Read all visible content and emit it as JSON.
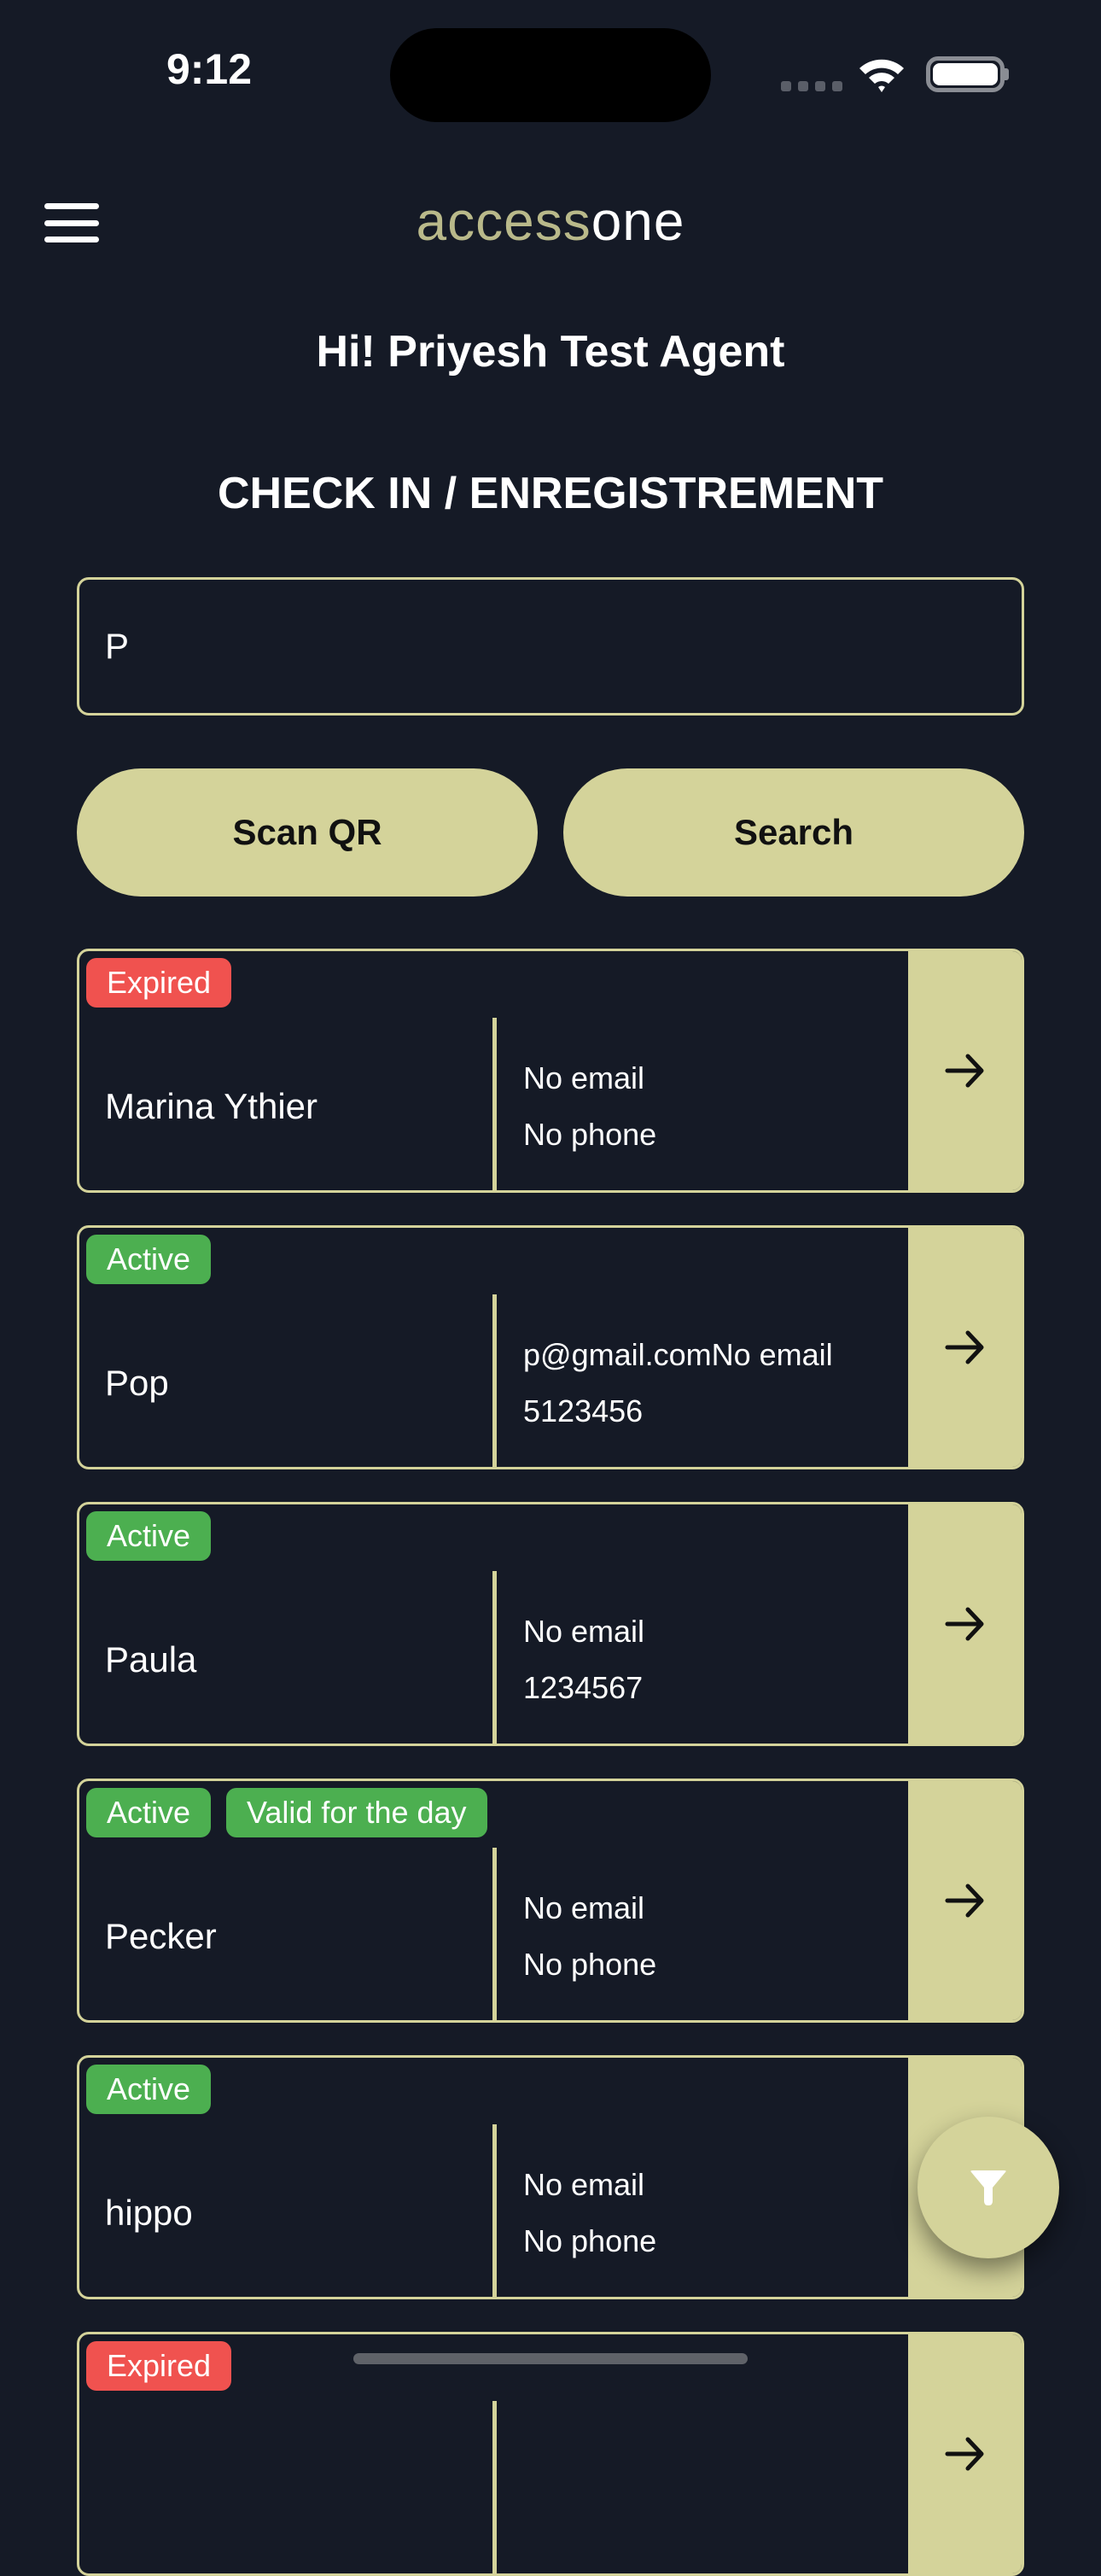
{
  "status_bar": {
    "time": "9:12",
    "signal-icon": "signal-dots",
    "wifi-icon": "wifi",
    "battery-icon": "battery-full"
  },
  "header": {
    "menu_icon": "hamburger-menu",
    "logo_part1": "access",
    "logo_part2": "one"
  },
  "greeting": "Hi! Priyesh Test Agent",
  "page_title": "CHECK IN / ENREGISTREMENT",
  "search": {
    "value": "P"
  },
  "buttons": {
    "scan_qr": "Scan QR",
    "search": "Search"
  },
  "colors": {
    "background": "#151a26",
    "accent": "#d4d39a",
    "expired": "#f0524f",
    "active": "#4caf50"
  },
  "members": [
    {
      "badges": [
        {
          "label": "Expired",
          "type": "expired"
        }
      ],
      "name": "Marina Ythier",
      "email": "No email",
      "phone": "No phone"
    },
    {
      "badges": [
        {
          "label": "Active",
          "type": "active"
        }
      ],
      "name": "Pop",
      "email": "p@gmail.comNo email",
      "phone": "5123456"
    },
    {
      "badges": [
        {
          "label": "Active",
          "type": "active"
        }
      ],
      "name": "Paula",
      "email": "No email",
      "phone": "1234567"
    },
    {
      "badges": [
        {
          "label": "Active",
          "type": "active"
        },
        {
          "label": "Valid for the day",
          "type": "active"
        }
      ],
      "name": "Pecker",
      "email": "No email",
      "phone": "No phone"
    },
    {
      "badges": [
        {
          "label": "Active",
          "type": "active"
        }
      ],
      "name": "hippo",
      "email": "No email",
      "phone": "No phone"
    },
    {
      "badges": [
        {
          "label": "Expired",
          "type": "expired"
        }
      ],
      "name": "",
      "email": "",
      "phone": ""
    }
  ],
  "fab": {
    "icon": "filter"
  }
}
